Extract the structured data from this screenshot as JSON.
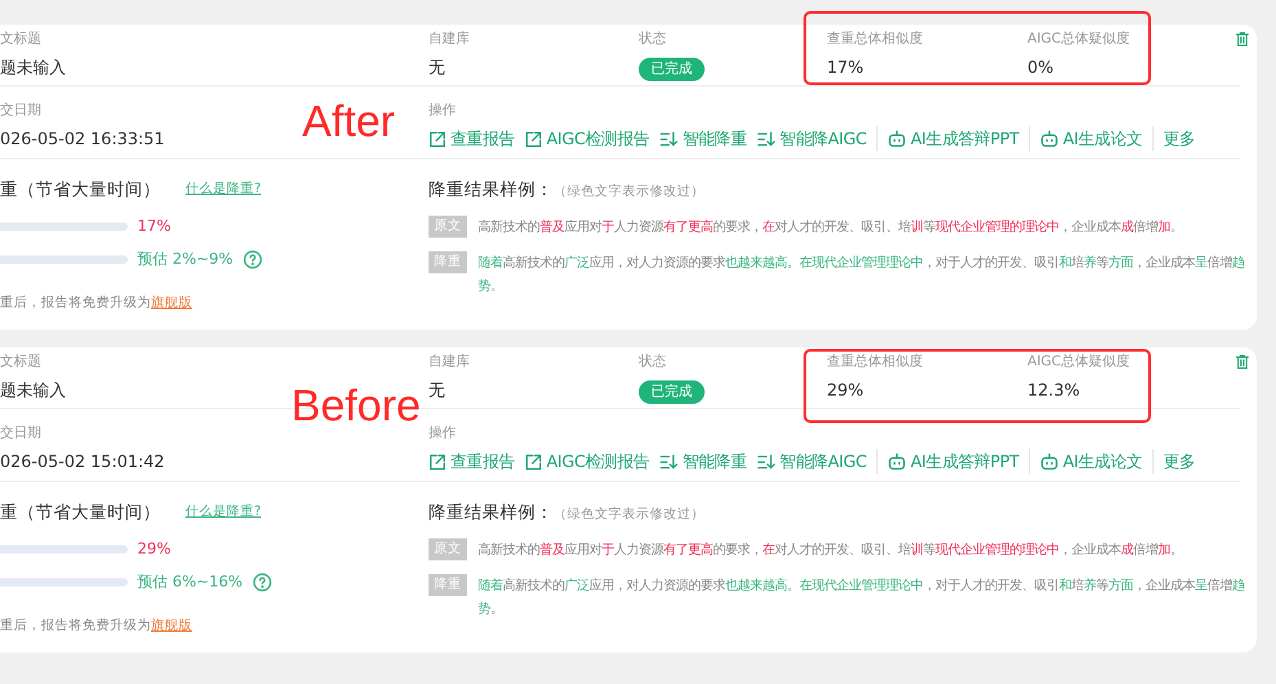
{
  "cards": [
    {
      "annotation": "After",
      "highlighted": true,
      "title_label": "文标题",
      "title": "题未输入",
      "library_label": "自建库",
      "library": "无",
      "status_label": "状态",
      "status": "已完成",
      "similarity_label": "查重总体相似度",
      "similarity": "17%",
      "aigc_label": "AIGC总体疑似度",
      "aigc": "0%",
      "date_label": "交日期",
      "date": "026-05-02 16:33:51",
      "actions_label": "操作",
      "actions": [
        {
          "label": "查重报告",
          "kind": "external"
        },
        {
          "label": "AIGC检测报告",
          "kind": "external"
        },
        {
          "label": "智能降重",
          "kind": "sort"
        },
        {
          "label": "智能降AIGC",
          "kind": "sort"
        },
        {
          "label": "AI生成答辩PPT",
          "kind": "robot"
        },
        {
          "label": "AI生成论文",
          "kind": "robot"
        },
        {
          "label": "更多",
          "kind": "text"
        }
      ],
      "reduce_title": "重（节省大量时间）",
      "reduce_help": "什么是降重?",
      "bars": [
        {
          "kind": "current",
          "reading": "17%"
        },
        {
          "kind": "estimate",
          "reading": "预估 2%~9%"
        }
      ],
      "upgrade_note": "重后，报告将免费升级为",
      "upgrade_link": "旗舰版",
      "sample_title": "降重结果样例：",
      "sample_note": "（绿色文字表示修改过）",
      "samples": [
        {
          "tag": "原文",
          "kind": "original",
          "segments": [
            {
              "text": "高新技术的",
              "changed": false
            },
            {
              "text": "普及",
              "changed": true
            },
            {
              "text": "应用对",
              "changed": false
            },
            {
              "text": "于",
              "changed": true
            },
            {
              "text": "人力资源",
              "changed": false
            },
            {
              "text": "有了更高",
              "changed": true
            },
            {
              "text": "的要求，",
              "changed": false
            },
            {
              "text": "在",
              "changed": true
            },
            {
              "text": "对人才的开发、吸引",
              "changed": false
            },
            {
              "text": "、",
              "changed": true
            },
            {
              "text": "培",
              "changed": false
            },
            {
              "text": "训",
              "changed": true
            },
            {
              "text": "等",
              "changed": false
            },
            {
              "text": "现代企业管理的理论中",
              "changed": true
            },
            {
              "text": "，企业成本",
              "changed": false
            },
            {
              "text": "成",
              "changed": true
            },
            {
              "text": "倍增",
              "changed": false
            },
            {
              "text": "加",
              "changed": true
            },
            {
              "text": "。",
              "changed": false
            }
          ]
        },
        {
          "tag": "降重",
          "kind": "rewritten",
          "segments": [
            {
              "text": "随着",
              "changed": true
            },
            {
              "text": "高新技术的",
              "changed": false
            },
            {
              "text": "广泛",
              "changed": true
            },
            {
              "text": "应用，对人力资源的要求",
              "changed": false
            },
            {
              "text": "也越来越高。在现代企业管理理论中",
              "changed": true
            },
            {
              "text": "，对于人才的开发、吸引",
              "changed": false
            },
            {
              "text": "和",
              "changed": true
            },
            {
              "text": "培",
              "changed": false
            },
            {
              "text": "养",
              "changed": true
            },
            {
              "text": "等",
              "changed": false
            },
            {
              "text": "方面",
              "changed": true
            },
            {
              "text": "，企业成本",
              "changed": false
            },
            {
              "text": "呈",
              "changed": true
            },
            {
              "text": "倍增",
              "changed": false
            },
            {
              "text": "趋势",
              "changed": true
            },
            {
              "text": "。",
              "changed": false
            }
          ]
        }
      ]
    },
    {
      "annotation": "Before",
      "highlighted": true,
      "title_label": "文标题",
      "title": "题未输入",
      "library_label": "自建库",
      "library": "无",
      "status_label": "状态",
      "status": "已完成",
      "similarity_label": "查重总体相似度",
      "similarity": "29%",
      "aigc_label": "AIGC总体疑似度",
      "aigc": "12.3%",
      "date_label": "交日期",
      "date": "026-05-02 15:01:42",
      "actions_label": "操作",
      "actions": [
        {
          "label": "查重报告",
          "kind": "external"
        },
        {
          "label": "AIGC检测报告",
          "kind": "external"
        },
        {
          "label": "智能降重",
          "kind": "sort"
        },
        {
          "label": "智能降AIGC",
          "kind": "sort"
        },
        {
          "label": "AI生成答辩PPT",
          "kind": "robot"
        },
        {
          "label": "AI生成论文",
          "kind": "robot"
        },
        {
          "label": "更多",
          "kind": "text"
        }
      ],
      "reduce_title": "重（节省大量时间）",
      "reduce_help": "什么是降重?",
      "bars": [
        {
          "kind": "current",
          "reading": "29%"
        },
        {
          "kind": "estimate",
          "reading": "预估 6%~16%"
        }
      ],
      "upgrade_note": "重后，报告将免费升级为",
      "upgrade_link": "旗舰版",
      "sample_title": "降重结果样例：",
      "sample_note": "（绿色文字表示修改过）",
      "samples": [
        {
          "tag": "原文",
          "kind": "original",
          "segments": [
            {
              "text": "高新技术的",
              "changed": false
            },
            {
              "text": "普及",
              "changed": true
            },
            {
              "text": "应用对",
              "changed": false
            },
            {
              "text": "于",
              "changed": true
            },
            {
              "text": "人力资源",
              "changed": false
            },
            {
              "text": "有了更高",
              "changed": true
            },
            {
              "text": "的要求，",
              "changed": false
            },
            {
              "text": "在",
              "changed": true
            },
            {
              "text": "对人才的开发、吸引",
              "changed": false
            },
            {
              "text": "、",
              "changed": true
            },
            {
              "text": "培",
              "changed": false
            },
            {
              "text": "训",
              "changed": true
            },
            {
              "text": "等",
              "changed": false
            },
            {
              "text": "现代企业管理的理论中",
              "changed": true
            },
            {
              "text": "，企业成本",
              "changed": false
            },
            {
              "text": "成",
              "changed": true
            },
            {
              "text": "倍增",
              "changed": false
            },
            {
              "text": "加",
              "changed": true
            },
            {
              "text": "。",
              "changed": false
            }
          ]
        },
        {
          "tag": "降重",
          "kind": "rewritten",
          "segments": [
            {
              "text": "随着",
              "changed": true
            },
            {
              "text": "高新技术的",
              "changed": false
            },
            {
              "text": "广泛",
              "changed": true
            },
            {
              "text": "应用，对人力资源的要求",
              "changed": false
            },
            {
              "text": "也越来越高。在现代企业管理理论中",
              "changed": true
            },
            {
              "text": "，对于人才的开发、吸引",
              "changed": false
            },
            {
              "text": "和",
              "changed": true
            },
            {
              "text": "培",
              "changed": false
            },
            {
              "text": "养",
              "changed": true
            },
            {
              "text": "等",
              "changed": false
            },
            {
              "text": "方面",
              "changed": true
            },
            {
              "text": "，企业成本",
              "changed": false
            },
            {
              "text": "呈",
              "changed": true
            },
            {
              "text": "倍增",
              "changed": false
            },
            {
              "text": "趋势",
              "changed": true
            },
            {
              "text": "。",
              "changed": false
            }
          ]
        }
      ]
    }
  ]
}
